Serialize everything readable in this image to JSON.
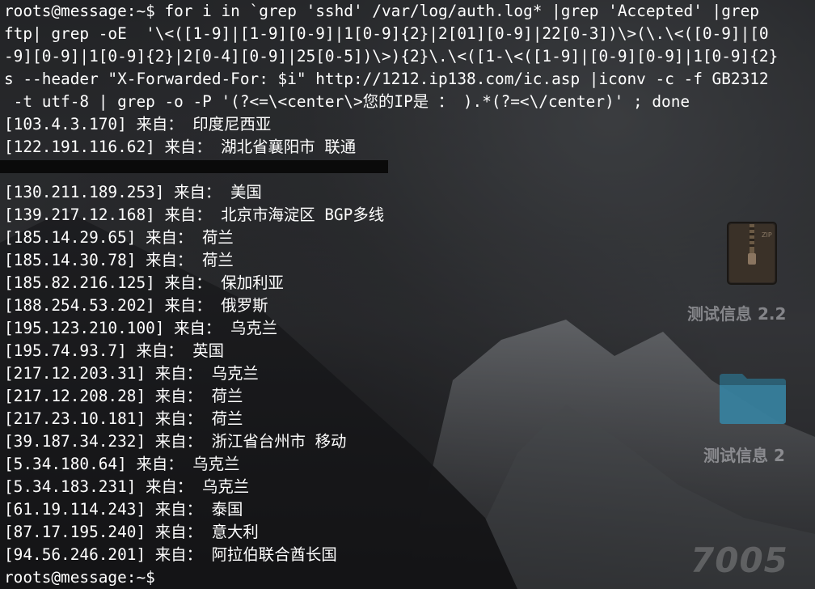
{
  "terminal": {
    "lines": [
      "roots@message:~$ for i in `grep 'sshd' /var/log/auth.log* |grep 'Accepted' |grep",
      "ftp| grep -oE  '\\<([1-9]|[1-9][0-9]|1[0-9]{2}|2[01][0-9]|22[0-3])\\>(\\.\\<([0-9]|[0",
      "-9][0-9]|1[0-9]{2}|2[0-4][0-9]|25[0-5])\\>){2}\\.\\<([1-\\<([1-9]|[0-9][0-9]|1[0-9]{2}",
      "s --header \"X-Forwarded-For: $i\" http://1212.ip138.com/ic.asp |iconv -c -f GB2312",
      " -t utf-8 | grep -o -P '(?<=\\<center\\>您的IP是 ： ).*(?=<\\/center)' ; done",
      "[103.4.3.170] 来自： 印度尼西亚",
      "[122.191.116.62] 来自： 湖北省襄阳市 联通",
      "",
      "[130.211.189.253] 来自： 美国",
      "[139.217.12.168] 来自： 北京市海淀区 BGP多线",
      "[185.14.29.65] 来自： 荷兰",
      "[185.14.30.78] 来自： 荷兰",
      "[185.82.216.125] 来自： 保加利亚",
      "[188.254.53.202] 来自： 俄罗斯",
      "[195.123.210.100] 来自： 乌克兰",
      "[195.74.93.7] 来自： 英国",
      "[217.12.203.31] 来自： 乌克兰",
      "[217.12.208.28] 来自： 荷兰",
      "[217.23.10.181] 来自： 荷兰",
      "[39.187.34.232] 来自： 浙江省台州市 移动",
      "[5.34.180.64] 来自： 乌克兰",
      "[5.34.183.231] 来自： 乌克兰",
      "[61.19.114.243] 来自： 泰国",
      "[87.17.195.240] 来自： 意大利",
      "[94.56.246.201] 来自： 阿拉伯联合酋长国",
      "roots@message:~$"
    ]
  },
  "desktop": {
    "icons": [
      {
        "label": "测试信息 2.2",
        "icon": "zip-archive-icon"
      },
      {
        "label": "测试信息 2",
        "icon": "folder-icon"
      }
    ],
    "watermark": "7005"
  },
  "colors": {
    "terminal_text": "#ffffff",
    "background": "#3a3c3f"
  }
}
